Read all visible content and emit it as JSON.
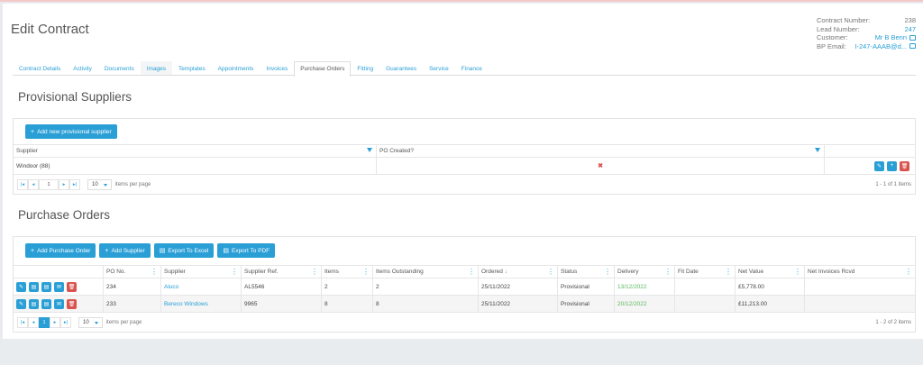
{
  "page": {
    "title": "Edit Contract"
  },
  "info": {
    "contract_number_label": "Contract Number:",
    "contract_number": "238",
    "lead_number_label": "Lead Number:",
    "lead_number": "247",
    "customer_label": "Customer:",
    "customer": "Mr B Benn",
    "bp_email_label": "BP Email:",
    "bp_email": "I-247-AAAB@d..."
  },
  "tabs": [
    "Contract Details",
    "Activity",
    "Documents",
    "Images",
    "Templates",
    "Appointments",
    "Invoices",
    "Purchase Orders",
    "Fitting",
    "Guarantees",
    "Service",
    "Finance"
  ],
  "provisional": {
    "title": "Provisional Suppliers",
    "add_button": "Add new provisional supplier",
    "columns": [
      "Supplier",
      "PO Created?"
    ],
    "rows": [
      {
        "supplier": "Windoor (88)",
        "po_created": "✖"
      }
    ],
    "pager": {
      "page": "1",
      "per_page": "10",
      "per_page_label": "items per page",
      "summary": "1 - 1 of 1 items"
    }
  },
  "purchase_orders": {
    "title": "Purchase Orders",
    "buttons": {
      "add_po": "Add Purchase Order",
      "add_supplier": "Add Supplier",
      "export_excel": "Export To Excel",
      "export_pdf": "Export To PDF"
    },
    "columns": [
      "PO No.",
      "Supplier",
      "Supplier Ref.",
      "Items",
      "Items Outstanding",
      "Ordered",
      "Status",
      "Delivery",
      "Fit Date",
      "Net Value",
      "Net Invoices Rcvd"
    ],
    "sort_indicator": "↓",
    "rows": [
      {
        "po": "234",
        "supplier": "Aluco",
        "ref": "AL5546",
        "items": "2",
        "outstanding": "2",
        "ordered": "25/11/2022",
        "status": "Provisional",
        "delivery": "13/12/2022",
        "fit_date": "",
        "net_value": "£5,778.00",
        "net_invoices": ""
      },
      {
        "po": "233",
        "supplier": "Bereco Windows",
        "ref": "9965",
        "items": "8",
        "outstanding": "8",
        "ordered": "25/11/2022",
        "status": "Provisional",
        "delivery": "20/12/2022",
        "fit_date": "",
        "net_value": "£11,213.00",
        "net_invoices": ""
      }
    ],
    "pager": {
      "page": "1",
      "per_page": "10",
      "per_page_label": "items per page",
      "summary": "1 - 2 of 2 items"
    }
  },
  "colors": {
    "accent": "#2a9fd6",
    "danger": "#d9534f",
    "success": "#5cb85c"
  }
}
